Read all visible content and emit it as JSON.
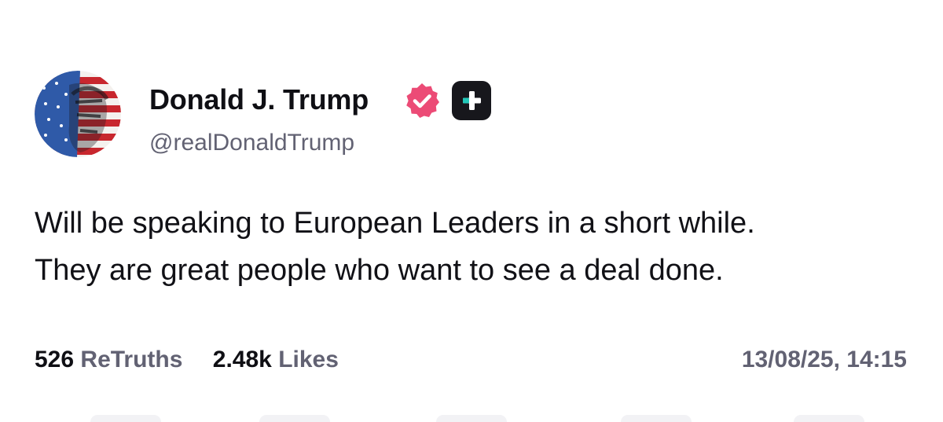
{
  "post": {
    "author": {
      "display_name": "Donald J. Trump",
      "handle": "@realDonaldTrump",
      "verified": true,
      "verified_badge_icon": "verified-badge-icon",
      "verified_badge_color": "#ec4b76",
      "plus_badge_icon": "plus-badge-icon"
    },
    "text_lines": [
      "Will be speaking to European Leaders in a short while.",
      "They are great people who want to see a deal done."
    ],
    "stats": {
      "retruths_count": "526",
      "retruths_label": "ReTruths",
      "likes_count": "2.48k",
      "likes_label": "Likes"
    },
    "timestamp": "13/08/25, 14:15"
  },
  "colors": {
    "text_primary": "#0f0f14",
    "text_secondary": "#626273",
    "verified_pink": "#ec4b76",
    "plus_badge_bg": "#17171c",
    "plus_badge_accent": "#22c7b8"
  }
}
